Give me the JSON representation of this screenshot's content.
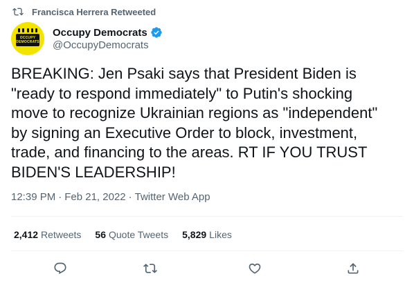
{
  "retweet_banner": {
    "text": "Francisca Herrera Retweeted",
    "icon": "retweet-icon"
  },
  "author": {
    "display_name": "Occupy Democrats",
    "handle": "@OccupyDemocrats",
    "avatar_text_line1": "OCCUPY",
    "avatar_text_line2": "DEMOCRATS",
    "verified_icon": "verified-badge-icon",
    "verified_color": "#1d9bf0",
    "avatar_color": "#f3e400"
  },
  "tweet": {
    "text": "BREAKING: Jen Psaki says that President Biden is\n\"ready to respond immediately\" to Putin's shocking\nmove to recognize Ukrainian regions as \"independent\"\nby signing an Executive Order to block, investment,\ntrade, and financing to the areas. RT IF YOU TRUST\nBIDEN'S LEADERSHIP!",
    "time": "12:39 PM",
    "separator": "·",
    "date": "Feb 21, 2022",
    "source": "Twitter Web App"
  },
  "stats": {
    "retweets": {
      "count": "2,412",
      "label": "Retweets"
    },
    "quotes": {
      "count": "56",
      "label": "Quote Tweets"
    },
    "likes": {
      "count": "5,829",
      "label": "Likes"
    }
  },
  "actions": [
    "reply-icon",
    "retweet-icon",
    "like-icon",
    "share-icon"
  ],
  "colors": {
    "text": "#0f1419",
    "secondary": "#536471",
    "divider": "#eff3f4"
  }
}
